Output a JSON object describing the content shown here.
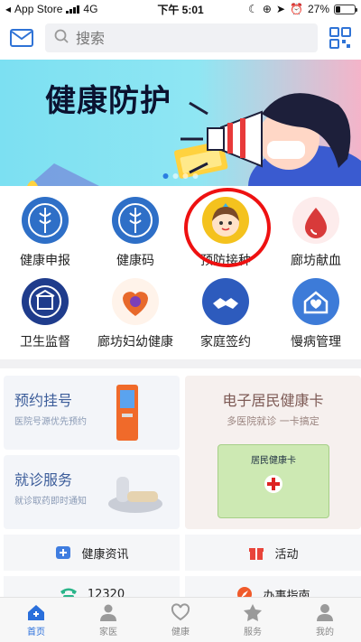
{
  "status_bar": {
    "carrier": "App Store",
    "network": "4G",
    "time": "下午 5:01",
    "battery": "27%",
    "battery_level": 0.27
  },
  "header": {
    "mail_icon": "mail-icon",
    "search_placeholder": "搜索",
    "qr_icon": "qr-scan-icon"
  },
  "banner": {
    "title": "健康防护",
    "slides": 4,
    "active_slide": 1
  },
  "services": [
    {
      "label": "健康申报",
      "icon": "hospital-emblem-icon",
      "color": "#2e6fc7"
    },
    {
      "label": "健康码",
      "icon": "hospital-emblem-icon",
      "color": "#2e6fc7"
    },
    {
      "label": "预防接种",
      "icon": "child-face-icon",
      "color": "#f4c21e"
    },
    {
      "label": "廊坊献血",
      "icon": "blood-drop-icon",
      "color": "#d83a3a"
    },
    {
      "label": "卫生监督",
      "icon": "shield-emblem-icon",
      "color": "#1f3c8c"
    },
    {
      "label": "廊坊妇幼健康",
      "icon": "mother-child-icon",
      "color": "#e8692b"
    },
    {
      "label": "家庭签约",
      "icon": "handshake-icon",
      "color": "#2d5bbd"
    },
    {
      "label": "慢病管理",
      "icon": "house-heart-icon",
      "color": "#3d7bd8"
    }
  ],
  "cards": {
    "appointment": {
      "title": "预约挂号",
      "subtitle": "医院号源优先预约"
    },
    "visit": {
      "title": "就诊服务",
      "subtitle": "就诊取药即时通知"
    },
    "health_card": {
      "title": "电子居民健康卡",
      "subtitle": "多医院就诊 一卡搞定",
      "card_label": "居民健康卡"
    }
  },
  "rows": [
    {
      "label": "健康资讯",
      "icon": "news-plus-icon",
      "color": "#3f7de0"
    },
    {
      "label": "活动",
      "icon": "gift-icon",
      "color": "#e8443a"
    },
    {
      "label": "12320",
      "icon": "phone-icon",
      "color": "#2bb58a"
    },
    {
      "label": "办事指南",
      "icon": "compass-icon",
      "color": "#f05a2a"
    }
  ],
  "tabbar": [
    {
      "label": "首页",
      "icon": "home-icon",
      "active": true
    },
    {
      "label": "家医",
      "icon": "doctor-icon",
      "active": false
    },
    {
      "label": "健康",
      "icon": "heart-icon",
      "active": false
    },
    {
      "label": "服务",
      "icon": "star-icon",
      "active": false
    },
    {
      "label": "我的",
      "icon": "user-icon",
      "active": false
    }
  ]
}
